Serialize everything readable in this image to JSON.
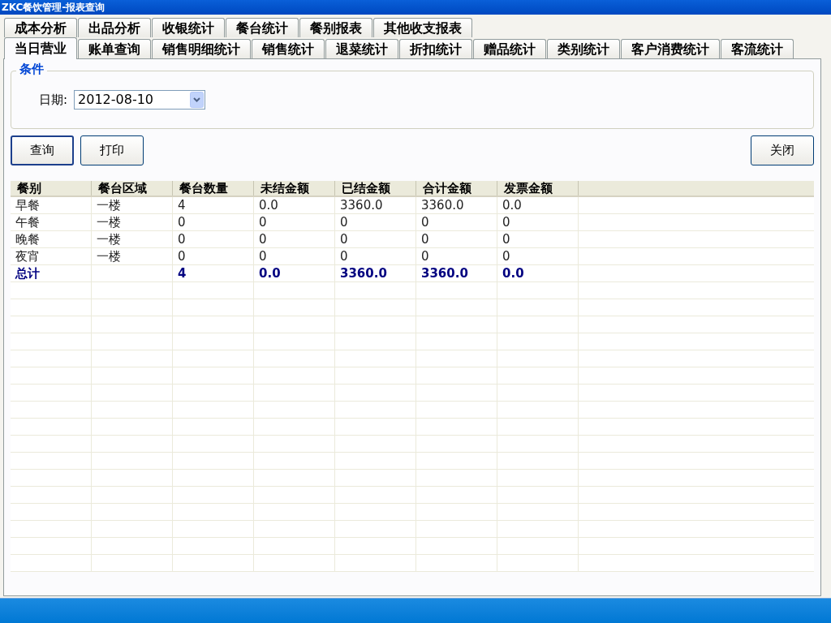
{
  "window": {
    "title": "ZKC餐饮管理-报表查询"
  },
  "tab_rows": [
    [
      {
        "label": "成本分析",
        "selected": false
      },
      {
        "label": "出品分析",
        "selected": false
      },
      {
        "label": "收银统计",
        "selected": false
      },
      {
        "label": "餐台统计",
        "selected": false
      },
      {
        "label": "餐别报表",
        "selected": false
      },
      {
        "label": "其他收支报表",
        "selected": false
      }
    ],
    [
      {
        "label": "当日营业",
        "selected": true
      },
      {
        "label": "账单查询",
        "selected": false
      },
      {
        "label": "销售明细统计",
        "selected": false
      },
      {
        "label": "销售统计",
        "selected": false
      },
      {
        "label": "退菜统计",
        "selected": false
      },
      {
        "label": "折扣统计",
        "selected": false
      },
      {
        "label": "赠品统计",
        "selected": false
      },
      {
        "label": "类别统计",
        "selected": false
      },
      {
        "label": "客户消费统计",
        "selected": false
      },
      {
        "label": "客流统计",
        "selected": false
      }
    ]
  ],
  "conditions": {
    "title": "条件",
    "date_label": "日期:",
    "date_value": "2012-08-10"
  },
  "buttons": {
    "left": [
      "查询",
      "打印"
    ],
    "right": [
      "关闭"
    ]
  },
  "table": {
    "columns": [
      "餐别",
      "餐台区域",
      "餐台数量",
      "未结金额",
      "已结金额",
      "合计金额",
      "发票金额"
    ],
    "rows": [
      {
        "kind": "data",
        "cells": [
          "早餐",
          "一楼",
          "4",
          "0.0",
          "3360.0",
          "3360.0",
          "0.0"
        ]
      },
      {
        "kind": "data",
        "cells": [
          "午餐",
          "一楼",
          "0",
          "0",
          "0",
          "0",
          "0"
        ]
      },
      {
        "kind": "data",
        "cells": [
          "晚餐",
          "一楼",
          "0",
          "0",
          "0",
          "0",
          "0"
        ]
      },
      {
        "kind": "data",
        "cells": [
          "夜宵",
          "一楼",
          "0",
          "0",
          "0",
          "0",
          "0"
        ]
      },
      {
        "kind": "total",
        "cells": [
          "总计",
          "",
          "4",
          "0.0",
          "3360.0",
          "3360.0",
          "0.0"
        ]
      }
    ]
  }
}
